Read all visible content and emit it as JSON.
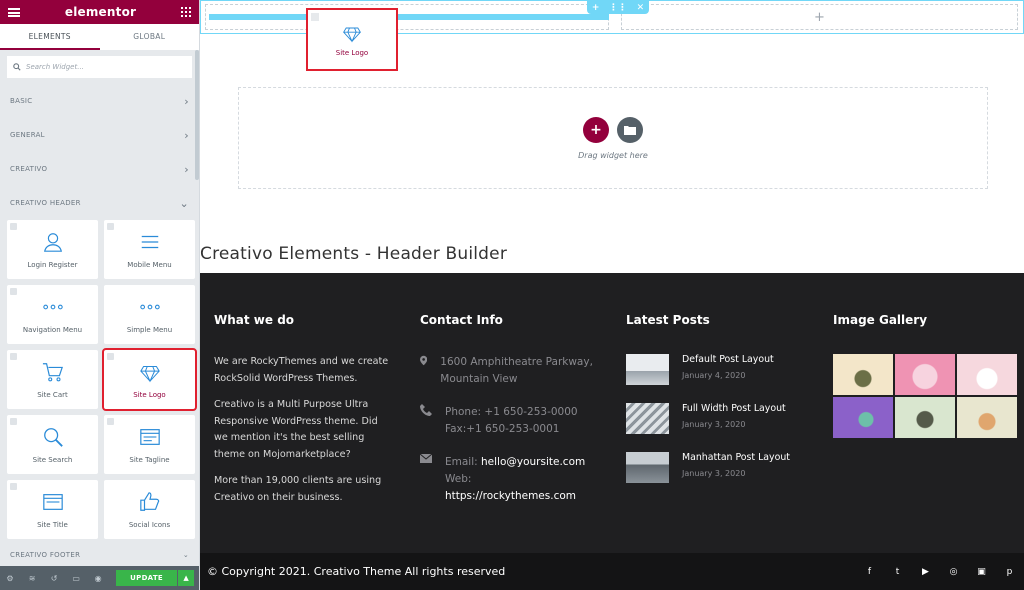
{
  "panel": {
    "brand": "elementor",
    "tabs": [
      "ELEMENTS",
      "GLOBAL"
    ],
    "search_placeholder": "Search Widget...",
    "categories": [
      "BASIC",
      "GENERAL",
      "CREATIVO",
      "CREATIVO HEADER"
    ],
    "widgets": [
      {
        "label": "Login Register",
        "icon": "user-icon"
      },
      {
        "label": "Mobile Menu",
        "icon": "menu-lines-icon"
      },
      {
        "label": "Navigation Menu",
        "icon": "dots-icon"
      },
      {
        "label": "Simple Menu",
        "icon": "dots-icon"
      },
      {
        "label": "Site Cart",
        "icon": "cart-icon"
      },
      {
        "label": "Site Logo",
        "icon": "diamond-icon"
      },
      {
        "label": "Site Search",
        "icon": "search-icon"
      },
      {
        "label": "Site Tagline",
        "icon": "tagline-icon"
      },
      {
        "label": "Site Title",
        "icon": "title-icon"
      },
      {
        "label": "Social Icons",
        "icon": "thumbs-up-icon"
      }
    ],
    "footer_category": "CREATIVO FOOTER",
    "update_label": "UPDATE",
    "accent": "#93003c",
    "selected_outline": "#e0202f"
  },
  "canvas": {
    "logo_widget_label": "Site Logo",
    "drop_hint": "Drag widget here",
    "page_title": "Creativo Elements - Header Builder",
    "footer": {
      "what_we_do": {
        "heading": "What we do",
        "paragraphs": [
          "We are RockyThemes and we create RockSolid WordPress Themes.",
          "Creativo is a Multi Purpose Ultra Responsive WordPress theme. Did we mention it's the best selling theme on Mojomarketplace?",
          "More than 19,000 clients are using Creativo on their business."
        ]
      },
      "contact": {
        "heading": "Contact Info",
        "address": "1600 Amphitheatre Parkway, Mountain View",
        "phone": "Phone: +1 650-253-0000",
        "fax": "Fax:+1 650-253-0001",
        "email_label": "Email:",
        "email": "hello@yoursite.com",
        "web_label": "Web:",
        "web": "https://rockythemes.com"
      },
      "posts": {
        "heading": "Latest Posts",
        "items": [
          {
            "title": "Default Post Layout",
            "date": "January 4, 2020"
          },
          {
            "title": "Full Width Post Layout",
            "date": "January 3, 2020"
          },
          {
            "title": "Manhattan Post Layout",
            "date": "January 3, 2020"
          }
        ]
      },
      "gallery": {
        "heading": "Image Gallery"
      }
    },
    "copyright": "© Copyright 2021. Creativo Theme All rights reserved"
  }
}
